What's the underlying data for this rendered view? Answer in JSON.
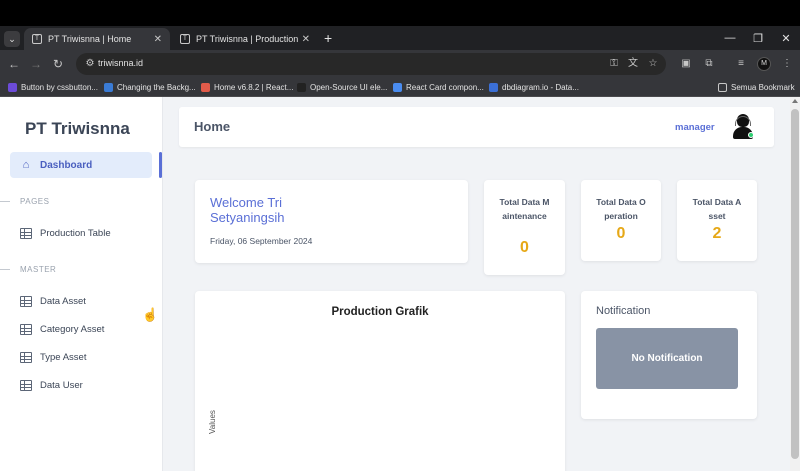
{
  "browser": {
    "tabs": [
      {
        "title": "PT Triwisnna | Home",
        "active": true
      },
      {
        "title": "PT Triwisnna | Production Table",
        "active": false
      }
    ],
    "new_tab": "+",
    "url": "triwisnna.id",
    "bookmarks": [
      {
        "label": "Button by cssbutton...",
        "color": "#6c4bd8"
      },
      {
        "label": "Changing the Backg...",
        "color": "#3a7bd5"
      },
      {
        "label": "Home v6.8.2 | React...",
        "color": "#e25b4a"
      },
      {
        "label": "Open-Source UI ele...",
        "color": "#222222"
      },
      {
        "label": "React Card compon...",
        "color": "#4a8cf0"
      },
      {
        "label": "dbdiagram.io - Data...",
        "color": "#3b6fd6"
      },
      {
        "label": "Semua Bookmark",
        "color": "#c7c7c7"
      }
    ],
    "profile_initial": "M"
  },
  "sidebar": {
    "brand": "PT Triwisnna",
    "active_item": "Dashboard",
    "sections": [
      {
        "label": "PAGES",
        "items": [
          "Production Table"
        ]
      },
      {
        "label": "MASTER",
        "items": [
          "Data Asset",
          "Category Asset",
          "Type Asset",
          "Data User"
        ]
      }
    ]
  },
  "header": {
    "title": "Home",
    "user_role": "manager"
  },
  "welcome": {
    "title": "Welcome Tri Setyaningsih",
    "date": "Friday, 06 September 2024"
  },
  "stats": [
    {
      "label": "Total Data Maintenance",
      "value": "0"
    },
    {
      "label": "Total Data Operation",
      "value": "0"
    },
    {
      "label": "Total Data Asset",
      "value": "2"
    }
  ],
  "chart": {
    "title": "Production Grafik",
    "ylabel": "Values"
  },
  "chart_data": {
    "type": "bar",
    "title": "Production Grafik",
    "ylabel": "Values",
    "xlabel": "",
    "categories": [],
    "values": []
  },
  "notification": {
    "title": "Notification",
    "empty_text": "No Notification"
  },
  "colors": {
    "accent": "#5a6fd6",
    "stat_value": "#e6a817",
    "notif_box": "#8893a5"
  }
}
